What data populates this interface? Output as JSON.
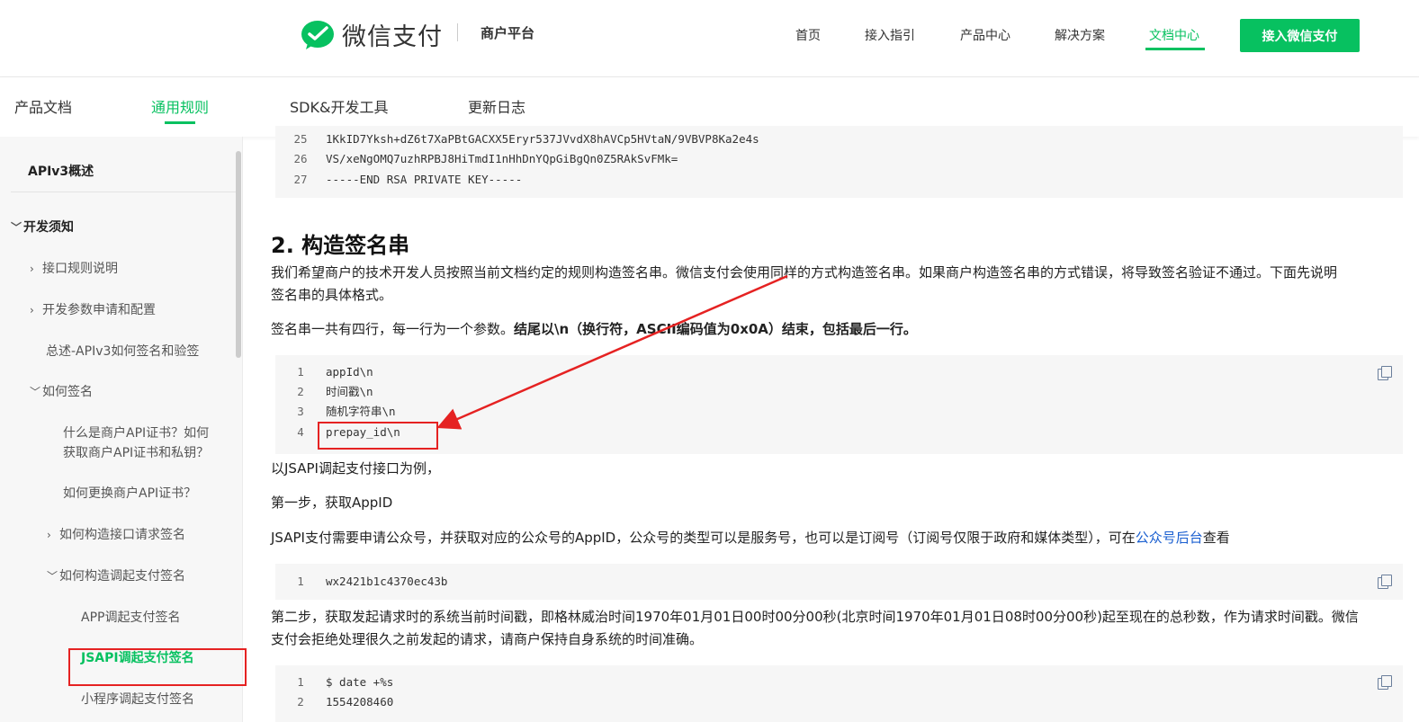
{
  "header": {
    "logo_text": "微信支付",
    "platform": "商户平台",
    "nav": [
      {
        "label": "首页"
      },
      {
        "label": "接入指引"
      },
      {
        "label": "产品中心"
      },
      {
        "label": "解决方案"
      },
      {
        "label": "文档中心",
        "active": true
      }
    ],
    "cta_label": "接入微信支付"
  },
  "subnav": [
    {
      "label": "产品文档"
    },
    {
      "label": "通用规则",
      "active": true
    },
    {
      "label": "SDK&开发工具"
    },
    {
      "label": "更新日志"
    }
  ],
  "sidebar": {
    "items": [
      {
        "label": "APIv3概述"
      },
      {
        "label": "开发须知",
        "chevron": "v"
      },
      {
        "label": "接口规则说明",
        "chevron": ">"
      },
      {
        "label": "开发参数申请和配置",
        "chevron": ">"
      },
      {
        "label": "总述-APIv3如何签名和验签"
      },
      {
        "label": "如何签名",
        "chevron": "v"
      },
      {
        "label_line1": "什么是商户API证书？如何",
        "label_line2": "获取商户API证书和私钥？"
      },
      {
        "label": "如何更换商户API证书？"
      },
      {
        "label": "如何构造接口请求签名",
        "chevron": ">"
      },
      {
        "label": "如何构造调起支付签名",
        "chevron": "v"
      },
      {
        "label": "APP调起支付签名"
      },
      {
        "label": "JSAPI调起支付签名",
        "active": true
      },
      {
        "label": "小程序调起支付签名"
      }
    ]
  },
  "content": {
    "code_top": [
      {
        "n": "25",
        "text": "1KkID7Yksh+dZ6t7XaPBtGACXX5Eryr537JVvdX8hAVCp5HVtaN/9VBVP8Ka2e4s"
      },
      {
        "n": "26",
        "text": "VS/xeNgOMQ7uzhRPBJ8HiTmdI1nHhDnYQpGiBgQn0Z5RAkSvFMk="
      },
      {
        "n": "27",
        "text": "-----END RSA PRIVATE KEY-----"
      }
    ],
    "heading": "2. 构造签名串",
    "para1_line1": "我们希望商户的技术开发人员按照当前文档约定的规则构造签名串。微信支付会使用同样的方式构造签名串。如果商户构造签名串的方式错误，将导致签名验证不通过。下面先说明",
    "para1_line2": "签名串的具体格式。",
    "para2_normal": "签名串一共有四行，每一行为一个参数。",
    "para2_bold": "结尾以\\n（换行符，ASCII编码值为0x0A）结束，包括最后一行。",
    "code_sig": [
      {
        "n": "1",
        "text": "appId\\n"
      },
      {
        "n": "2",
        "text": "时间戳\\n"
      },
      {
        "n": "3",
        "text": "随机字符串\\n"
      },
      {
        "n": "4",
        "text": "prepay_id\\n"
      }
    ],
    "para3": "以JSAPI调起支付接口为例，",
    "para4": "第一步，获取AppID",
    "para5_before": "JSAPI支付需要申请公众号，并获取对应的公众号的AppID，公众号的类型可以是服务号，也可以是订阅号（订阅号仅限于政府和媒体类型），可在",
    "para5_link": "公众号后台",
    "para5_after": "查看",
    "code_appid": [
      {
        "n": "1",
        "text": "wx2421b1c4370ec43b"
      }
    ],
    "para6_line1": "第二步，获取发起请求时的系统当前时间戳，即格林威治时间1970年01月01日00时00分00秒(北京时间1970年01月01日08时00分00秒)起至现在的总秒数，作为请求时间戳。微信",
    "para6_line2": "支付会拒绝处理很久之前发起的请求，请商户保持自身系统的时间准确。",
    "code_date": [
      {
        "n": "1",
        "text": "$ date +%s"
      },
      {
        "n": "2",
        "text": "1554208460"
      }
    ]
  },
  "colors": {
    "brand": "#07c160",
    "annotation": "#e52222",
    "link": "#1a5fd0"
  }
}
